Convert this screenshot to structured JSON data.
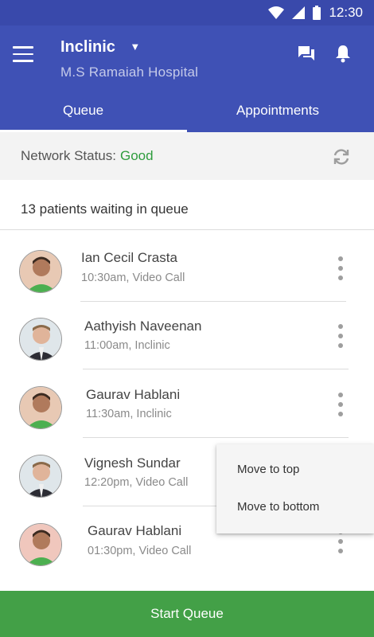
{
  "status_bar": {
    "time": "12:30"
  },
  "app_bar": {
    "title": "Inclinic",
    "subtitle": "M.S Ramaiah Hospital",
    "tabs": [
      {
        "label": "Queue",
        "selected": true
      },
      {
        "label": "Appointments",
        "selected": false
      }
    ]
  },
  "network": {
    "label": "Network Status:",
    "value": "Good",
    "value_color": "#2e9c3d"
  },
  "queue": {
    "summary": "13 patients waiting in queue",
    "patients": [
      {
        "name": "Ian Cecil Crasta",
        "meta": "10:30am, Video Call"
      },
      {
        "name": "Aathyish Naveenan",
        "meta": "11:00am, Inclinic"
      },
      {
        "name": "Gaurav Hablani",
        "meta": "11:30am, Inclinic"
      },
      {
        "name": "Vignesh Sundar",
        "meta": "12:20pm, Video Call"
      },
      {
        "name": "Gaurav Hablani",
        "meta": "01:30pm, Video Call"
      }
    ]
  },
  "popup_menu": {
    "items": [
      "Move to top",
      "Move to bottom"
    ]
  },
  "footer": {
    "button_label": "Start Queue",
    "color": "#43a047"
  },
  "colors": {
    "primary": "#3f51b5",
    "primary_dark": "#3949ab",
    "accent_green": "#43a047"
  },
  "icons": [
    "wifi-icon",
    "cellular-signal-icon",
    "battery-icon",
    "menu-icon",
    "dropdown-caret-icon",
    "chat-icon",
    "bell-icon",
    "refresh-icon",
    "more-vert-icon"
  ]
}
